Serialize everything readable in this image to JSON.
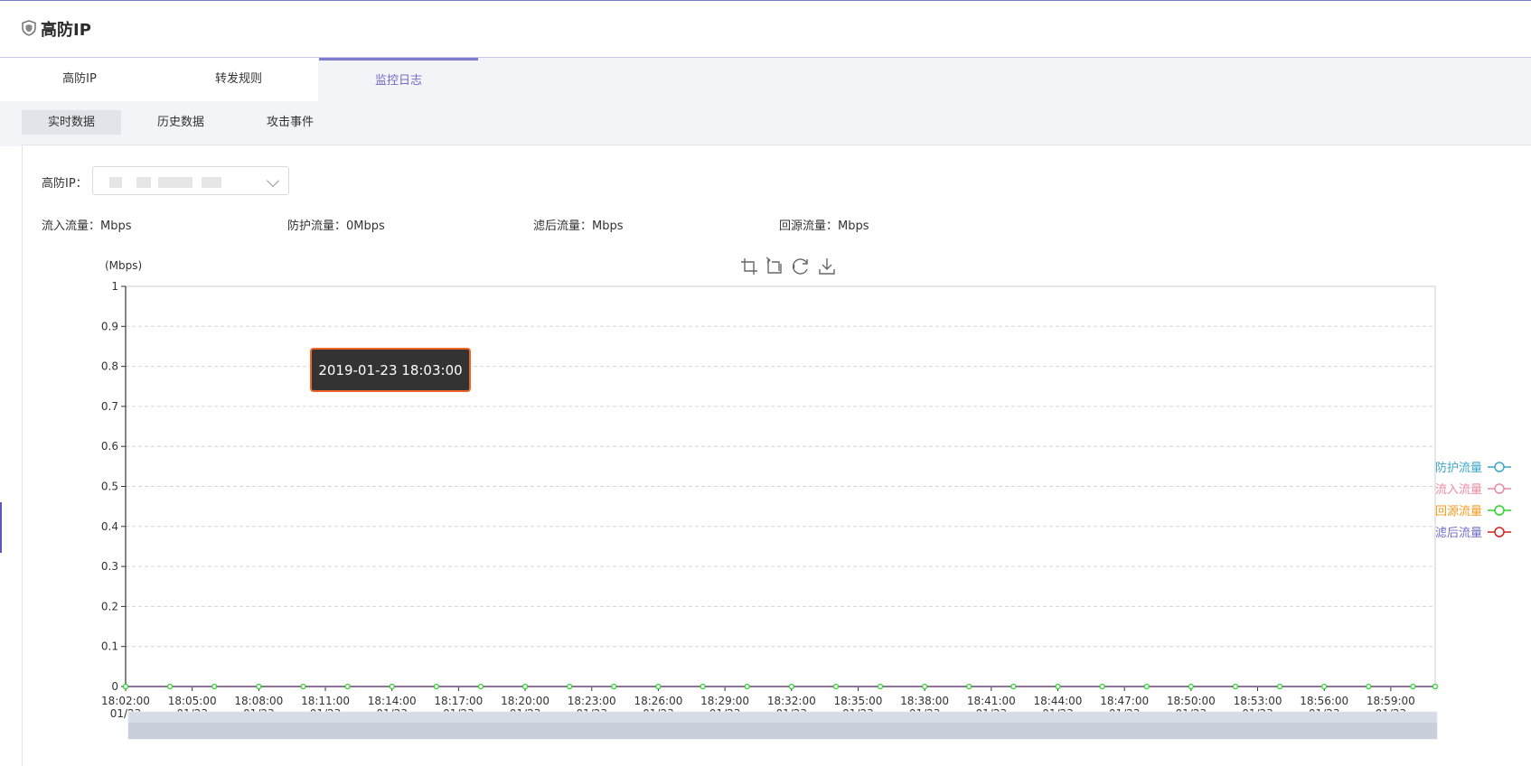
{
  "app": {
    "title": "高防IP"
  },
  "tabs": [
    {
      "label": "高防IP",
      "active": false
    },
    {
      "label": "转发规则",
      "active": false
    },
    {
      "label": "监控日志",
      "active": true
    }
  ],
  "subtabs": [
    {
      "label": "实时数据",
      "active": true
    },
    {
      "label": "历史数据",
      "active": false
    },
    {
      "label": "攻击事件",
      "active": false
    }
  ],
  "filter": {
    "ip_label": "高防IP：",
    "ip_value": ""
  },
  "stats": {
    "inflow": "流入流量：Mbps",
    "protect": "防护流量：0Mbps",
    "filtered": "滤后流量：Mbps",
    "origin": "回源流量：Mbps"
  },
  "toolbox": [
    "zoom-icon",
    "zoom-reset-icon",
    "restore-icon",
    "download-icon"
  ],
  "colors": {
    "accent": "#7f7dd0",
    "protect": "#3aa7c9",
    "inflow": "#e98aa3",
    "origin": "#f59b1c",
    "filtered": "#6f6dc4",
    "line_orange": "#f5841f",
    "point_green": "#2ed52e"
  },
  "chart_data": {
    "type": "line",
    "ylabel": "(Mbps)",
    "ylim": [
      0,
      1
    ],
    "yticks": [
      "1",
      "0.9",
      "0.8",
      "0.7",
      "0.6",
      "0.5",
      "0.4",
      "0.3",
      "0.2",
      "0.1",
      "0"
    ],
    "x_tick_labels": [
      {
        "time": "18:02:00",
        "date": "01/23"
      },
      {
        "time": "18:05:00",
        "date": "01/23"
      },
      {
        "time": "18:08:00",
        "date": "01/23"
      },
      {
        "time": "18:11:00",
        "date": "01/23"
      },
      {
        "time": "18:14:00",
        "date": "01/23"
      },
      {
        "time": "18:17:00",
        "date": "01/23"
      },
      {
        "time": "18:20:00",
        "date": "01/23"
      },
      {
        "time": "18:23:00",
        "date": "01/23"
      },
      {
        "time": "18:26:00",
        "date": "01/23"
      },
      {
        "time": "18:29:00",
        "date": "01/23"
      },
      {
        "time": "18:32:00",
        "date": "01/23"
      },
      {
        "time": "18:35:00",
        "date": "01/23"
      },
      {
        "time": "18:38:00",
        "date": "01/23"
      },
      {
        "time": "18:41:00",
        "date": "01/23"
      },
      {
        "time": "18:44:00",
        "date": "01/23"
      },
      {
        "time": "18:47:00",
        "date": "01/23"
      },
      {
        "time": "18:50:00",
        "date": "01/23"
      },
      {
        "time": "18:53:00",
        "date": "01/23"
      },
      {
        "time": "18:56:00",
        "date": "01/23"
      },
      {
        "time": "18:59:00",
        "date": "01/23"
      }
    ],
    "x_start": "18:02:00",
    "x_end": "19:01:00",
    "point_interval_minutes": 1,
    "series": [
      {
        "name": "防护流量",
        "values": "all 0"
      },
      {
        "name": "流入流量",
        "values": "all 0"
      },
      {
        "name": "回源流量",
        "values": "all 0"
      },
      {
        "name": "滤后流量",
        "values": "all 0"
      }
    ],
    "legend_position": "right",
    "grid": true,
    "tooltip": "2019-01-23 18:03:00"
  }
}
